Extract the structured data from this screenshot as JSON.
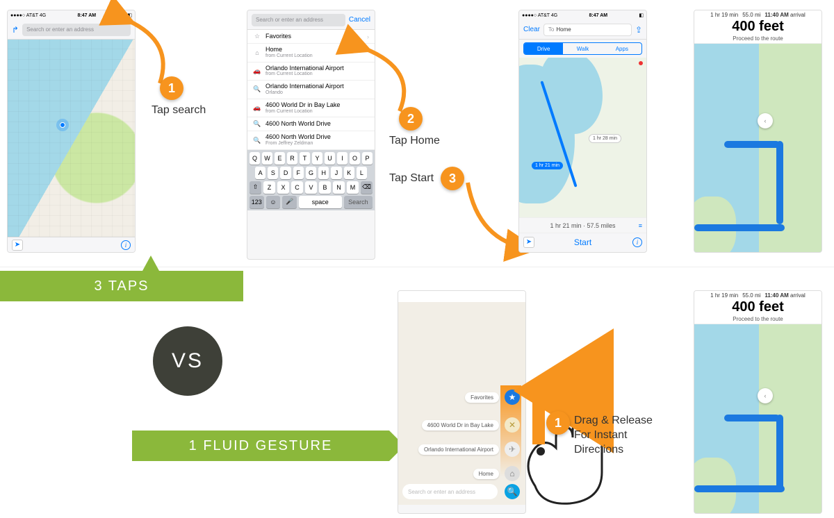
{
  "status_bar": {
    "carrier": "●●●●○ AT&T  4G",
    "time": "8:47 AM",
    "battery": "◧"
  },
  "search": {
    "placeholder": "Search or enter an address",
    "cancel": "Cancel"
  },
  "clear": "Clear",
  "to_prefix": "To",
  "to_value": "Home",
  "favorites": "Favorites",
  "suggestions": [
    {
      "title": "Home",
      "sub": "from Current Location"
    },
    {
      "title": "Orlando International Airport",
      "sub": "from Current Location"
    },
    {
      "title": "Orlando International Airport",
      "sub": "Orlando"
    },
    {
      "title": "4600 World Dr in Bay Lake",
      "sub": "from Current Location"
    },
    {
      "title": "4600 North World Drive",
      "sub": ""
    },
    {
      "title": "4600 North World Drive",
      "sub": "From Jeffrey Zeldman"
    }
  ],
  "keyboard": {
    "r1": [
      "Q",
      "W",
      "E",
      "R",
      "T",
      "Y",
      "U",
      "I",
      "O",
      "P"
    ],
    "r2": [
      "A",
      "S",
      "D",
      "F",
      "G",
      "H",
      "J",
      "K",
      "L"
    ],
    "r3": [
      "⇧",
      "Z",
      "X",
      "C",
      "V",
      "B",
      "N",
      "M",
      "⌫"
    ],
    "r4": {
      "num": "123",
      "emoji": "☺",
      "mic": "🎤",
      "space": "space",
      "search": "Search"
    }
  },
  "seg": {
    "drive": "Drive",
    "walk": "Walk",
    "apps": "Apps"
  },
  "route_summary": "1 hr 21 min · 57.5 miles",
  "route_pill": "1 hr 21 min",
  "route_pill2": "1 hr 28 min",
  "start": "Start",
  "list_icon": "≡",
  "nav": {
    "eta": "1 hr 19 min",
    "dist": "55.0 mi",
    "arrive_time": "11:40 AM",
    "arrive_lbl": "arrival",
    "next": "400 feet",
    "sub": "Proceed to the route"
  },
  "labels": {
    "s1": "Tap search",
    "s2": "Tap Home",
    "s3": "Tap Start",
    "taps": "3 TAPS",
    "vs": "VS",
    "gesture": "1 FLUID GESTURE",
    "drag": "Drag & Release",
    "drag2": "For Instant",
    "drag3": "Directions"
  },
  "gesture_chips": [
    "Favorites",
    "4600 World Dr in Bay Lake",
    "Orlando International Airport",
    "Home"
  ]
}
